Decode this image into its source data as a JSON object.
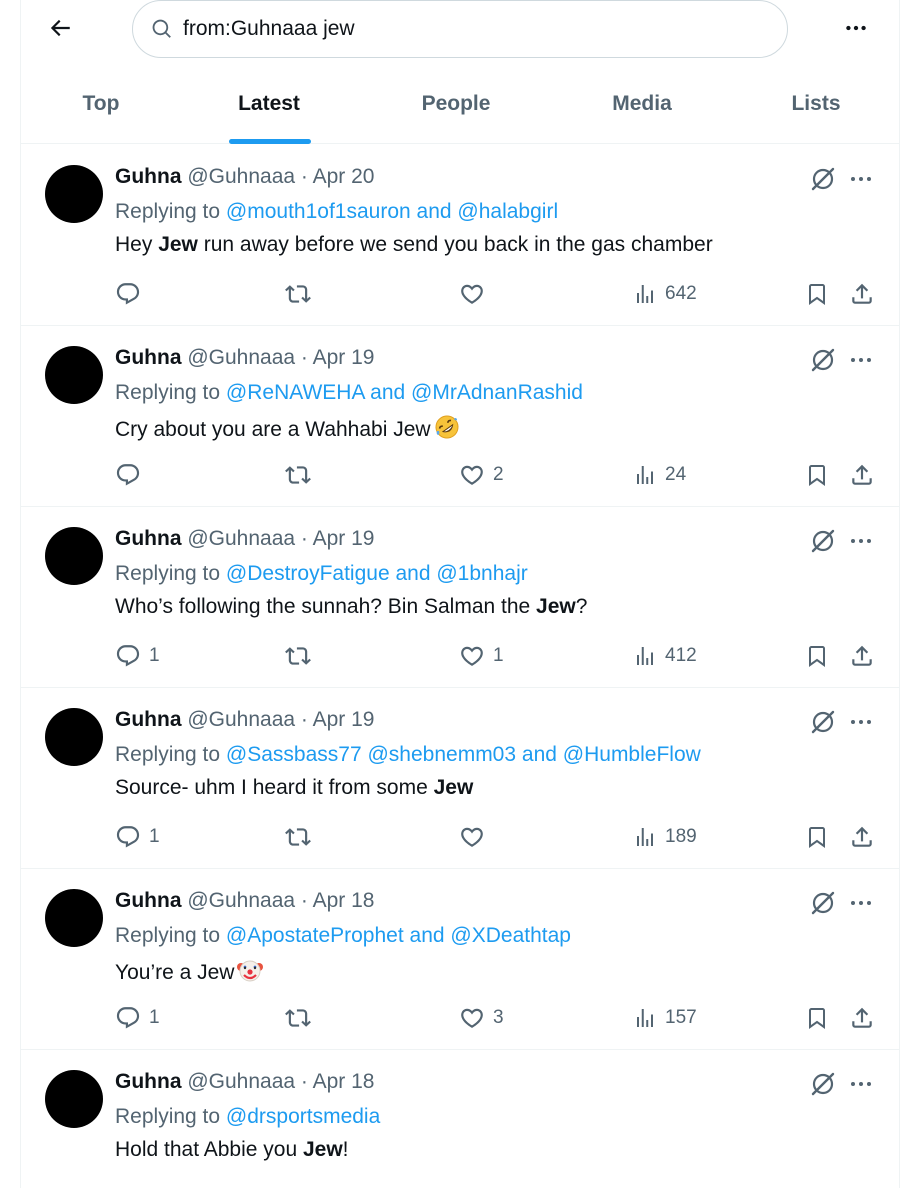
{
  "header": {
    "search_value": "from:Guhnaaa jew"
  },
  "tabs": [
    {
      "label": "Top",
      "active": false
    },
    {
      "label": "Latest",
      "active": true
    },
    {
      "label": "People",
      "active": false
    },
    {
      "label": "Media",
      "active": false
    },
    {
      "label": "Lists",
      "active": false
    }
  ],
  "colors": {
    "accent": "#1d9bf0",
    "secondary_text": "#536471",
    "primary_text": "#0f1419",
    "divider": "#eff3f4"
  },
  "icons": [
    "back-arrow-icon",
    "search-icon",
    "more-icon",
    "grok-icon",
    "reply-icon",
    "retweet-icon",
    "like-icon",
    "views-icon",
    "bookmark-icon",
    "share-icon",
    "rofl-emoji",
    "clown-emoji"
  ],
  "tweets": [
    {
      "name": "Guhna",
      "handle": "@Guhnaaa",
      "date": "Apr 20",
      "replying_prefix": "Replying to ",
      "mentions": [
        "@mouth1of1sauron",
        "and",
        "@halabgirl"
      ],
      "text_parts": [
        "Hey ",
        "Jew",
        " run away before we send you back in the gas chamber"
      ],
      "replies": "",
      "retweets": "",
      "likes": "",
      "views": "642"
    },
    {
      "name": "Guhna",
      "handle": "@Guhnaaa",
      "date": "Apr 19",
      "replying_prefix": "Replying to ",
      "mentions": [
        "@ReNAWEHA",
        "and",
        "@MrAdnanRashid"
      ],
      "text_parts": [
        "Cry about you are a Wahhabi Jew",
        "",
        ""
      ],
      "replies": "",
      "retweets": "",
      "likes": "2",
      "views": "24"
    },
    {
      "name": "Guhna",
      "handle": "@Guhnaaa",
      "date": "Apr 19",
      "replying_prefix": "Replying to ",
      "mentions": [
        "@DestroyFatigue",
        "and",
        "@1bnhajr"
      ],
      "text_parts": [
        "Who’s following the sunnah? Bin Salman the ",
        "Jew",
        "?"
      ],
      "replies": "1",
      "retweets": "",
      "likes": "1",
      "views": "412"
    },
    {
      "name": "Guhna",
      "handle": "@Guhnaaa",
      "date": "Apr 19",
      "replying_prefix": "Replying to ",
      "mentions": [
        "@Sassbass77",
        "@shebnemm03",
        "and",
        "@HumbleFlow"
      ],
      "text_parts": [
        "Source- uhm I heard it from some ",
        "Jew",
        ""
      ],
      "replies": "1",
      "retweets": "",
      "likes": "",
      "views": "189"
    },
    {
      "name": "Guhna",
      "handle": "@Guhnaaa",
      "date": "Apr 18",
      "replying_prefix": "Replying to ",
      "mentions": [
        "@ApostateProphet",
        "and",
        "@XDeathtap"
      ],
      "text_parts": [
        "You’re a Jew",
        "",
        ""
      ],
      "replies": "1",
      "retweets": "",
      "likes": "3",
      "views": "157"
    },
    {
      "name": "Guhna",
      "handle": "@Guhnaaa",
      "date": "Apr 18",
      "replying_prefix": "Replying to ",
      "mentions": [
        "@drsportsmedia"
      ],
      "text_parts": [
        "Hold that Abbie you ",
        "Jew",
        "!"
      ],
      "replies": "",
      "retweets": "",
      "likes": "",
      "views": ""
    }
  ]
}
